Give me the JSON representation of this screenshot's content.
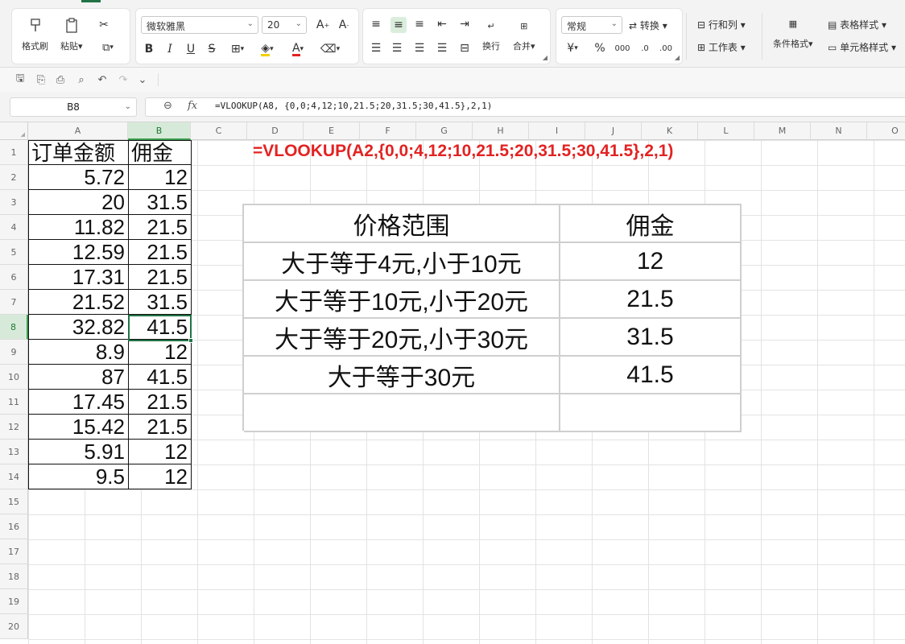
{
  "ribbon": {
    "format_painter": "格式刷",
    "paste": "粘贴",
    "font_name": "微软雅黑",
    "font_size": "20",
    "wrap": "换行",
    "merge": "合并",
    "number_format": "常规",
    "convert": "转换",
    "rows_cols": "行和列",
    "worksheet": "工作表",
    "cond_format": "条件格式",
    "table_style": "表格样式",
    "cell_style": "单元格样式",
    "percent": "%",
    "currency": "¥",
    "bold": "B",
    "italic": "I",
    "underline": "U",
    "strike": "S"
  },
  "formula_bar": {
    "name_box": "B8",
    "fx": "fx",
    "formula": "=VLOOKUP(A8, {0,0;4,12;10,21.5;20,31.5;30,41.5},2,1)"
  },
  "columns": [
    "A",
    "B",
    "C",
    "D",
    "E",
    "F",
    "G",
    "H",
    "I",
    "J",
    "K",
    "L",
    "M",
    "N",
    "O"
  ],
  "rows": [
    "1",
    "2",
    "3",
    "4",
    "5",
    "6",
    "7",
    "8",
    "9",
    "10",
    "11",
    "12",
    "13",
    "14",
    "15",
    "16",
    "17",
    "18",
    "19",
    "20"
  ],
  "sheet": {
    "header_a": "订单金额",
    "header_b": "佣金",
    "amounts": [
      "5.72",
      "20",
      "11.82",
      "12.59",
      "17.31",
      "21.52",
      "32.82",
      "8.9",
      "87",
      "17.45",
      "15.42",
      "5.91",
      "9.5"
    ],
    "commissions": [
      "12",
      "31.5",
      "21.5",
      "21.5",
      "21.5",
      "31.5",
      "41.5",
      "12",
      "41.5",
      "21.5",
      "21.5",
      "12",
      "12"
    ],
    "formula_note": "=VLOOKUP(A2,{0,0;4,12;10,21.5;20,31.5;30,41.5},2,1)"
  },
  "ref_table": {
    "header_range": "价格范围",
    "header_commission": "佣金",
    "ranges": [
      "大于等于4元,小于10元",
      "大于等于10元,小于20元",
      "大于等于20元,小于30元",
      "大于等于30元"
    ],
    "values": [
      "12",
      "21.5",
      "31.5",
      "41.5"
    ]
  },
  "colors": {
    "accent_green": "#217346",
    "formula_red": "#e32222"
  }
}
